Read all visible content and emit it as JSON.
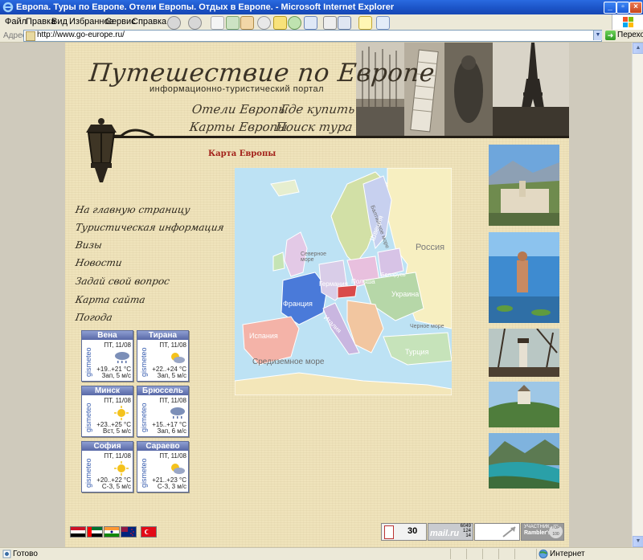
{
  "window": {
    "title": "Европа. Туры по Европе. Отели Европы. Отдых в Европе. - Microsoft Internet Explorer"
  },
  "menu": [
    "Файл",
    "Правка",
    "Вид",
    "Избранное",
    "Сервис",
    "Справка"
  ],
  "address": {
    "label": "Адрес:",
    "url": "http://www.go-europe.ru/",
    "go_label": "Переход"
  },
  "header": {
    "logo": "Путешествие по Европе",
    "subtitle": "информационно-туристический портал",
    "nav": [
      {
        "label": "Отели Европы"
      },
      {
        "label": "Где купить"
      },
      {
        "label": "Карты Европы"
      },
      {
        "label": "Поиск тура"
      }
    ]
  },
  "map": {
    "title": "Карта Европы",
    "labels": {
      "russia": "Россия",
      "north_sea": "Северное море",
      "baltic_sea": "Балтийское море",
      "finland": "Швеция",
      "belarus": "Беларусь",
      "poland": "Польша",
      "ukraine": "Украина",
      "germany": "Германия",
      "france": "Франция",
      "spain": "Испания",
      "italy": "Италия",
      "black_sea": "Черное море",
      "turkey": "Турция",
      "mediterranean": "Средиземное море"
    }
  },
  "left_nav": [
    {
      "label": "На главную страницу"
    },
    {
      "label": "Туристическая информация"
    },
    {
      "label": "Визы"
    },
    {
      "label": "Новости"
    },
    {
      "label": "Задай свой вопрос"
    },
    {
      "label": "Карта сайта"
    },
    {
      "label": "Погода"
    }
  ],
  "weather": [
    {
      "city": "Вена",
      "date": "ПТ, 11/08",
      "temp": "+19..+21 °C",
      "wind": "Зап, 5 м/с",
      "icon": "rain-cloud-icon"
    },
    {
      "city": "Тирана",
      "date": "ПТ, 11/08",
      "temp": "+22..+24 °C",
      "wind": "Зап, 5 м/с",
      "icon": "sun-cloud-icon"
    },
    {
      "city": "Минск",
      "date": "ПТ, 11/08",
      "temp": "+23..+25 °C",
      "wind": "Вст, 5 м/с",
      "icon": "sun-icon"
    },
    {
      "city": "Брюссель",
      "date": "ПТ, 11/08",
      "temp": "+15..+17 °C",
      "wind": "Зап, 6 м/с",
      "icon": "rain-cloud-icon"
    },
    {
      "city": "София",
      "date": "ПТ, 11/08",
      "temp": "+20..+22 °C",
      "wind": "С-З, 5 м/с",
      "icon": "sun-icon"
    },
    {
      "city": "Сараево",
      "date": "ПТ, 11/08",
      "temp": "+21..+23 °C",
      "wind": "С-З, 3 м/с",
      "icon": "sun-cloud-icon"
    }
  ],
  "weather_brand": "gismeteo",
  "counters": {
    "c1_value": "30",
    "c2_top": "6049",
    "c2_mid": "124",
    "c2_bot": "14",
    "c2_brand": "mail.ru",
    "rambler_line1": "УЧАСТНИК",
    "rambler_line2": "Rambler's",
    "rambler_badge": "TOP 100"
  },
  "status": {
    "ready": "Готово",
    "zone": "Интернет"
  }
}
